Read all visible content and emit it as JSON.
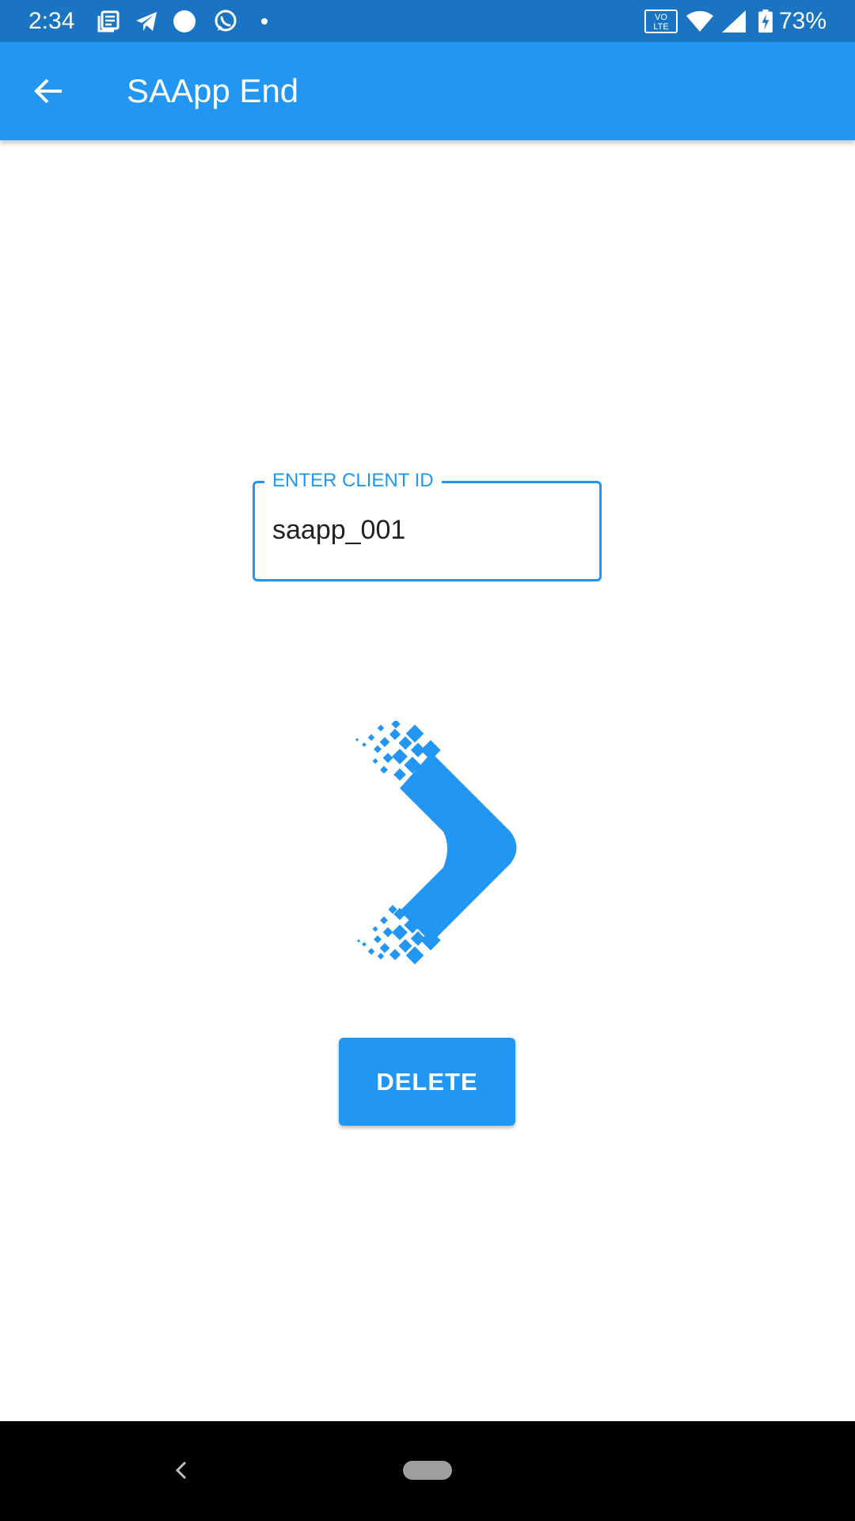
{
  "status_bar": {
    "time": "2:34",
    "battery": "73%",
    "icons": [
      "news-icon",
      "telegram-icon",
      "circle-notification-icon",
      "whatsapp-icon",
      "dot-icon",
      "volte-icon",
      "wifi-icon",
      "signal-icon",
      "battery-charging-icon"
    ],
    "volte_text_top": "VO",
    "volte_text_bottom": "LTE"
  },
  "app_bar": {
    "title": "SAApp End",
    "back_icon": "arrow-back-icon"
  },
  "client_field": {
    "label": "ENTER CLIENT ID",
    "value": "saapp_001"
  },
  "delete_button": {
    "label": "DELETE"
  },
  "nav_bar": {
    "back_icon": "nav-back-icon",
    "home_icon": "nav-home-pill"
  },
  "colors": {
    "status_bar": "#1a74c2",
    "primary": "#2196f3",
    "text": "#222222"
  }
}
